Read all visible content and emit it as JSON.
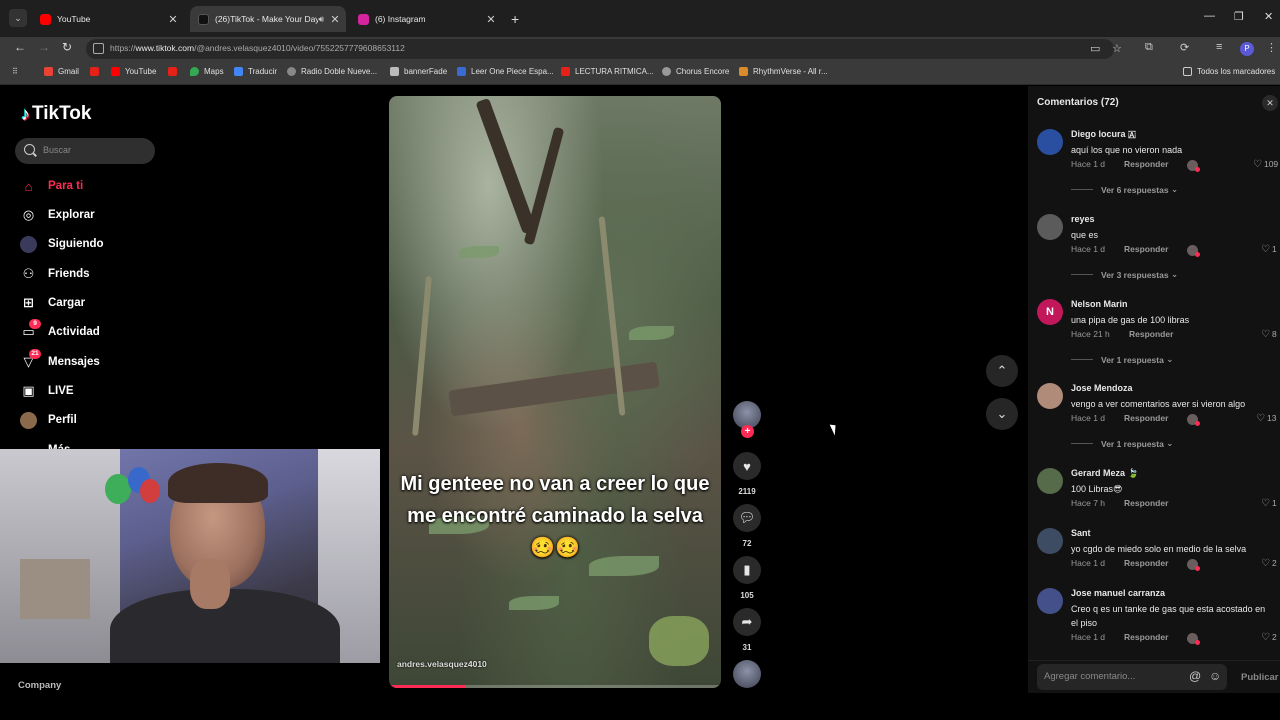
{
  "browser": {
    "tabs": [
      {
        "title": "YouTube",
        "favicon_color": "#ff0000",
        "active": false
      },
      {
        "title": "(26)TikTok - Make Your Day",
        "favicon_color": "#111111",
        "active": true,
        "audio": true
      },
      {
        "title": "(6) Instagram",
        "favicon_color": "#d6249f",
        "active": false
      }
    ],
    "url_prefix": "https://",
    "url_host": "www.tiktok.com",
    "url_path": "/@andres.velasquez4010/video/7552257779608653112",
    "bookmarks": [
      {
        "label": "Gmail",
        "color": "#ea4335"
      },
      {
        "label": "",
        "color": "#e62117"
      },
      {
        "label": "YouTube",
        "color": "#ff0000"
      },
      {
        "label": "",
        "color": "#e62117"
      },
      {
        "label": "Maps",
        "color": "#34a853"
      },
      {
        "label": "Traducir",
        "color": "#4285f4"
      },
      {
        "label": "Radio Doble Nueve...",
        "color": "#888888"
      },
      {
        "label": "bannerFade",
        "color": "#bbbbbb"
      },
      {
        "label": "Leer One Piece Espa...",
        "color": "#3b6ad1"
      },
      {
        "label": "LECTURA RITMICA...",
        "color": "#e62117"
      },
      {
        "label": "Chorus Encore",
        "color": "#999999"
      },
      {
        "label": "RhythmVerse - All r...",
        "color": "#d98a2b"
      }
    ],
    "all_bookmarks": "Todos los marcadores"
  },
  "sidebar": {
    "logo": "TikTok",
    "search_placeholder": "Buscar",
    "items": [
      {
        "label": "Para ti",
        "icon": "home-icon",
        "active": true
      },
      {
        "label": "Explorar",
        "icon": "compass-icon"
      },
      {
        "label": "Siguiendo",
        "icon": "following-icon"
      },
      {
        "label": "Friends",
        "icon": "friends-icon"
      },
      {
        "label": "Cargar",
        "icon": "upload-icon"
      },
      {
        "label": "Actividad",
        "icon": "activity-icon",
        "badge": "9"
      },
      {
        "label": "Mensajes",
        "icon": "messages-icon",
        "badge": "21"
      },
      {
        "label": "LIVE",
        "icon": "live-icon"
      },
      {
        "label": "Perfil",
        "icon": "profile-icon"
      },
      {
        "label": "Más",
        "icon": "more-icon"
      }
    ],
    "footer": "Company"
  },
  "video": {
    "caption": "Mi genteee no van a creer lo que me encontré caminado la selva 🥴🥴",
    "author": "andres.velasquez4010",
    "progress": 0.23
  },
  "actions": {
    "likes": "2119",
    "comments": "72",
    "saves": "105",
    "shares": "31"
  },
  "comments_panel": {
    "title": "Comentarios (72)",
    "input_placeholder": "Agregar comentario...",
    "post_label": "Publicar",
    "reply_label": "Responder",
    "items": [
      {
        "user": "Diego locura 🇦",
        "text": "aquí los que no vieron nada",
        "time": "Hace 1 d",
        "likes": "109",
        "replies": "Ver 6 respuestas",
        "avatar_color": "#2b4fa0"
      },
      {
        "user": "reyes",
        "text": "que es",
        "time": "Hace 1 d",
        "likes": "1",
        "replies": "Ver 3 respuestas",
        "avatar_color": "#5b5b5b"
      },
      {
        "user": "Nelson Marin",
        "text": "una pipa de gas de 100 libras",
        "time": "Hace 21 h",
        "likes": "8",
        "replies": "Ver 1 respuesta",
        "avatar_color": "#c2185b",
        "avatar_letter": "N"
      },
      {
        "user": "Jose Mendoza",
        "text": "vengo a ver comentarios aver si vieron algo",
        "time": "Hace 1 d",
        "likes": "13",
        "replies": "Ver 1 respuesta",
        "avatar_color": "#b08b7a"
      },
      {
        "user": "Gerard Meza 🍃",
        "text": "100 Libras😎",
        "time": "Hace 7 h",
        "likes": "1",
        "avatar_color": "#556b4a"
      },
      {
        "user": "Sant",
        "text": "yo cgdo de miedo solo en medio de la selva",
        "time": "Hace 1 d",
        "likes": "2",
        "avatar_color": "#3d4b63"
      },
      {
        "user": "Jose manuel carranza",
        "text": "Creo q es un tanke de gas que esta acostado en el piso",
        "time": "Hace 1 d",
        "likes": "2",
        "avatar_color": "#44508a"
      }
    ]
  }
}
